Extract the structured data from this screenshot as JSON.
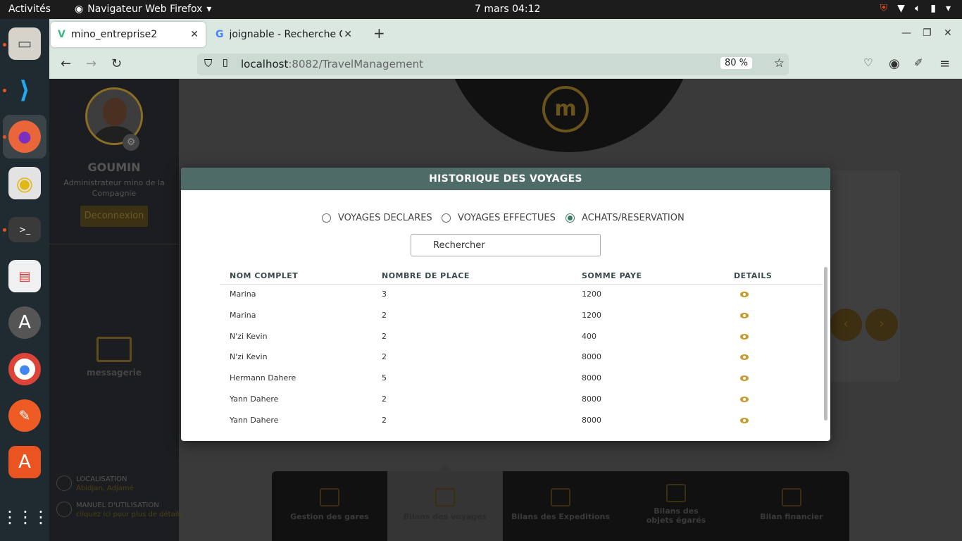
{
  "topbar": {
    "activities": "Activités",
    "app_name": "Navigateur Web Firefox",
    "clock": "7 mars  04:12"
  },
  "dock": {
    "items": [
      "files-icon",
      "vscode-icon",
      "firefox-icon",
      "rhythmbox-icon",
      "terminal-icon",
      "document-viewer-icon",
      "software-updater-icon",
      "chrome-icon",
      "postman-icon",
      "app-center-icon",
      "show-apps-icon"
    ]
  },
  "browser": {
    "tabs": [
      {
        "title": "mino_entreprise2"
      },
      {
        "title": "joignable - Recherche Go"
      }
    ],
    "url_host": "localhost",
    "url_path": ":8082/TravelManagement",
    "zoom": "80 %"
  },
  "sidebar": {
    "user_name": "GOUMIN",
    "user_role": "Administrateur mino de la Compagnie",
    "logout_label": "Deconnexion",
    "messaging_label": "messagerie",
    "location_title": "LOCALISATION",
    "location_value": "Abidjan, Adjamé",
    "manual_title": "MANUEL D'UTILISATION",
    "manual_link": "cliquez ici pour plus de détails"
  },
  "bottom_tabs": [
    {
      "label": "Gestion des gares"
    },
    {
      "label": "Bilans des voyages"
    },
    {
      "label": "Bilans des Expeditions"
    },
    {
      "label": "Bilans des objets égarés"
    },
    {
      "label": "Bilan financier"
    }
  ],
  "modal": {
    "title": "HISTORIQUE DES VOYAGES",
    "radios": [
      {
        "label": "VOYAGES DECLARES",
        "checked": false
      },
      {
        "label": "VOYAGES EFFECTUES",
        "checked": false
      },
      {
        "label": "ACHATS/RESERVATION",
        "checked": true
      }
    ],
    "search_placeholder": "Rechercher",
    "columns": [
      "NOM COMPLET",
      "NOMBRE DE PLACE",
      "SOMME PAYE",
      "DETAILS"
    ],
    "rows": [
      {
        "name": "Marina",
        "places": "3",
        "amount": "1200"
      },
      {
        "name": "Marina",
        "places": "2",
        "amount": "1200"
      },
      {
        "name": "N'zi Kevin",
        "places": "2",
        "amount": "400"
      },
      {
        "name": "N'zi Kevin",
        "places": "2",
        "amount": "8000"
      },
      {
        "name": "Hermann Dahere",
        "places": "5",
        "amount": "8000"
      },
      {
        "name": "Yann Dahere",
        "places": "2",
        "amount": "8000"
      },
      {
        "name": "Yann Dahere",
        "places": "2",
        "amount": "8000"
      }
    ]
  },
  "colors": {
    "header": "#4f6b67",
    "accent_gold": "#c99a2e",
    "radio_checked": "#3b7a62"
  }
}
